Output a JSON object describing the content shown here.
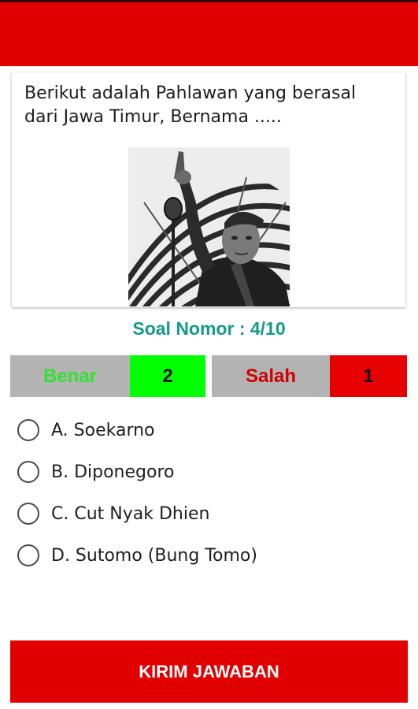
{
  "colors": {
    "app_bar": "#e00000",
    "soal_text": "#159a8a",
    "benar_text": "#31e331",
    "benar_value_bg": "#00ff00",
    "salah_text": "#d10000",
    "salah_value_bg": "#e60000",
    "score_label_bg": "#b3b3b3",
    "submit_bg": "#e00000"
  },
  "question": {
    "text": "Berikut adalah Pahlawan yang berasal dari Jawa Timur, Bernama .....",
    "image": "black-and-white photo of a man in a cap pointing upward in front of a microphone and a striped umbrella"
  },
  "progress": {
    "label": "Soal Nomor : 4/10"
  },
  "score": {
    "benar_label": "Benar",
    "benar_value": "2",
    "salah_label": "Salah",
    "salah_value": "1"
  },
  "options": [
    {
      "label": "A. Soekarno",
      "selected": false
    },
    {
      "label": "B. Diponegoro",
      "selected": false
    },
    {
      "label": "C. Cut Nyak Dhien",
      "selected": false
    },
    {
      "label": "D. Sutomo (Bung Tomo)",
      "selected": false
    }
  ],
  "submit": {
    "label": "KIRIM JAWABAN"
  }
}
